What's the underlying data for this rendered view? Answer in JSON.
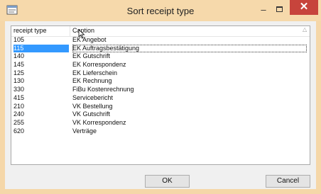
{
  "window": {
    "title": "Sort receipt type",
    "minimize_label": "–",
    "close_label": "✕"
  },
  "table": {
    "columns": [
      "receipt type",
      "Caption"
    ],
    "sort_indicator": "△",
    "selected_index": 1,
    "rows": [
      {
        "type": "105",
        "caption": "EK Angebot"
      },
      {
        "type": "115",
        "caption": "EK Auftragsbestätigung"
      },
      {
        "type": "140",
        "caption": "EK Gutschrift"
      },
      {
        "type": "145",
        "caption": "EK Korrespondenz"
      },
      {
        "type": "125",
        "caption": "EK Lieferschein"
      },
      {
        "type": "130",
        "caption": "EK Rechnung"
      },
      {
        "type": "330",
        "caption": "FiBu Kostenrechnung"
      },
      {
        "type": "415",
        "caption": "Servicebericht"
      },
      {
        "type": "210",
        "caption": "VK Bestellung"
      },
      {
        "type": "240",
        "caption": "VK Gutschrift"
      },
      {
        "type": "255",
        "caption": "VK Korrespondenz"
      },
      {
        "type": "620",
        "caption": "Verträge"
      }
    ]
  },
  "buttons": {
    "ok_label": "OK",
    "cancel_label": "Cancel"
  },
  "colors": {
    "titlebar": "#f6d9ab",
    "close": "#c7443c",
    "selection": "#3399ff"
  }
}
